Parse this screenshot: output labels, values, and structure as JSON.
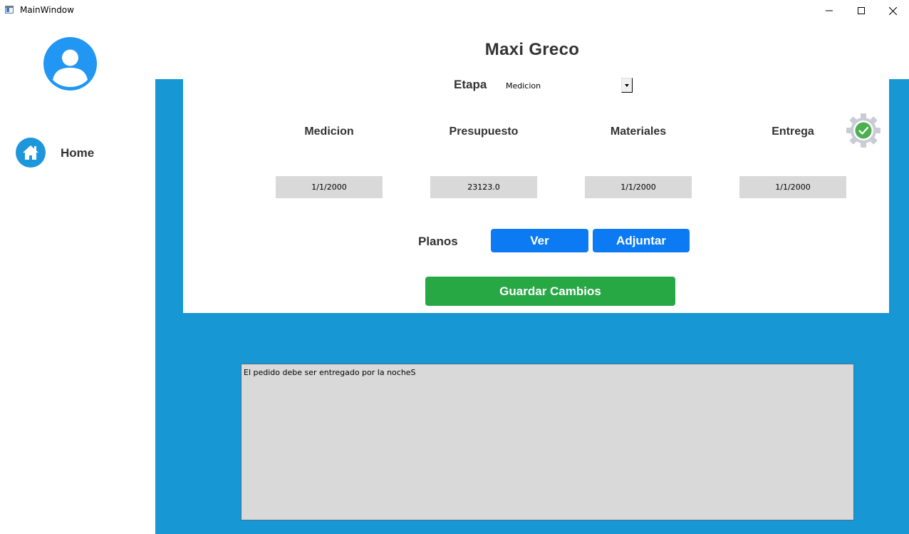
{
  "window": {
    "title": "MainWindow",
    "icons": {
      "minimize": "minimize-icon",
      "maximize": "maximize-icon",
      "close": "close-icon"
    }
  },
  "sidebar": {
    "avatar_icon": "user-avatar-icon",
    "items": [
      {
        "label": "Home",
        "icon": "home-icon"
      }
    ]
  },
  "header": {
    "client_name": "Maxi Greco"
  },
  "etapa": {
    "label": "Etapa",
    "selected": "Medicion"
  },
  "stages": {
    "columns": [
      {
        "header": "Medicion",
        "value": "1/1/2000"
      },
      {
        "header": "Presupuesto",
        "value": "23123.0"
      },
      {
        "header": "Materiales",
        "value": "1/1/2000"
      },
      {
        "header": "Entrega",
        "value": "1/1/2000"
      }
    ],
    "status_icon": "gear-check-icon"
  },
  "planos": {
    "label": "Planos",
    "view_label": "Ver",
    "attach_label": "Adjuntar"
  },
  "save_label": "Guardar Cambios",
  "notes": {
    "text": "El pedido debe ser entregado por la nocheS"
  },
  "colors": {
    "sidebar_bg": "#ffffff",
    "content_bg": "#1797d4",
    "avatar": "#2196f3",
    "button_blue": "#0c7bf3",
    "button_green": "#28a745",
    "field_bg": "#d9d9d9",
    "gear_check": "#4caf50"
  }
}
